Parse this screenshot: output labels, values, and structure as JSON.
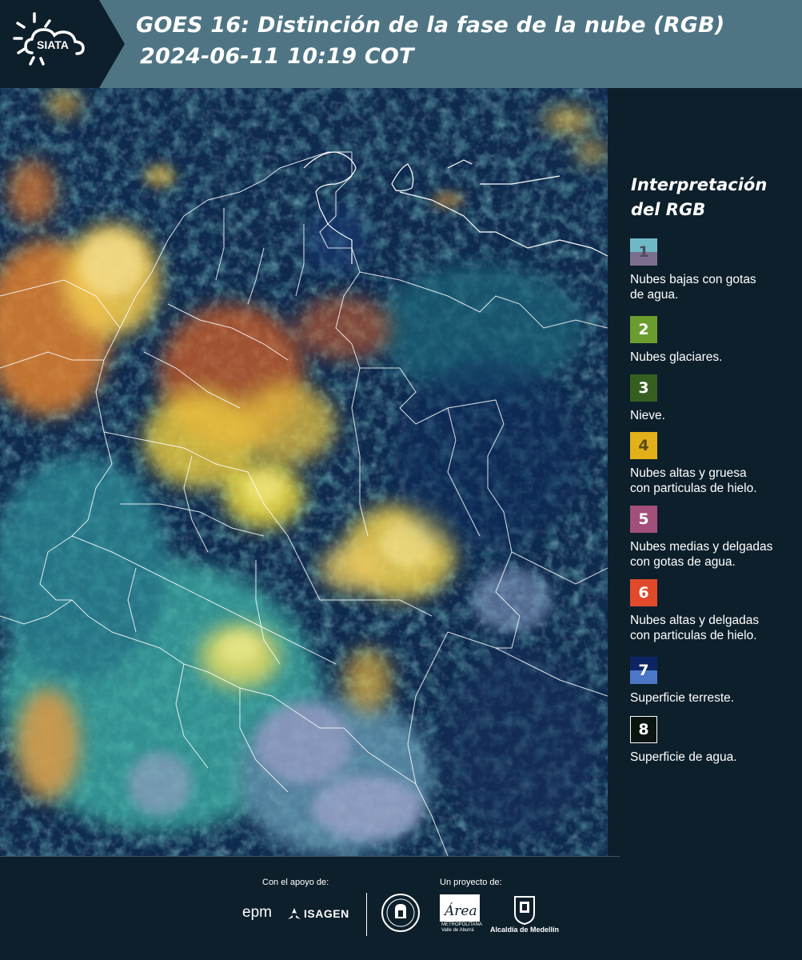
{
  "header": {
    "logo_text": "SIATA",
    "title_line1": "GOES 16: Distinción de la fase de la nube (RGB)",
    "title_line2": "2024-06-11 10:19 COT"
  },
  "legend": {
    "title_line1": "Interpretación",
    "title_line2": "del RGB",
    "items": [
      {
        "number": "1",
        "text_lines": [
          "Nubes bajas con gotas",
          "de agua."
        ],
        "color_top": "#6fb9c7",
        "color_bottom": "#7b6f8f",
        "number_color": "#4d4d5a"
      },
      {
        "number": "2",
        "text_lines": [
          "Nubes glaciares."
        ],
        "color_top": "#6b9c2e",
        "color_bottom": "#6b9c2e",
        "number_color": "#ffffff"
      },
      {
        "number": "3",
        "text_lines": [
          "Nieve."
        ],
        "color_top": "#355e1f",
        "color_bottom": "#355e1f",
        "number_color": "#ffffff"
      },
      {
        "number": "4",
        "text_lines": [
          "Nubes altas y gruesa",
          "con particulas de hielo."
        ],
        "color_top": "#e3b019",
        "color_bottom": "#e3b019",
        "number_color": "#5a4a1a"
      },
      {
        "number": "5",
        "text_lines": [
          "Nubes medias y delgadas",
          "con gotas de agua."
        ],
        "color_top": "#a24f7c",
        "color_bottom": "#a24f7c",
        "number_color": "#ffffff"
      },
      {
        "number": "6",
        "text_lines": [
          "Nubes altas y delgadas",
          "con particulas de hielo."
        ],
        "color_top": "#e04a2a",
        "color_bottom": "#e04a2a",
        "number_color": "#ffffff"
      },
      {
        "number": "7",
        "text_lines": [
          "Superficie terreste."
        ],
        "color_top": "#0e2563",
        "color_bottom": "#4c77c6",
        "number_color": "#ffffff"
      },
      {
        "number": "8",
        "text_lines": [
          "Superficie de agua."
        ],
        "color_top": "#0a1410",
        "color_bottom": "#0a1410",
        "number_color": "#ffffff"
      }
    ]
  },
  "footer": {
    "support_label": "Con el apoyo de:",
    "project_label": "Un proyecto de:",
    "epm_logo": "epm",
    "isagen_logo": "ISAGEN",
    "area_logo_lines": [
      "METROPOLITANA",
      "Valle de Aburrá"
    ],
    "area_logo_word": "Área",
    "alcaldia_label": "Alcaldía de Medellín"
  }
}
